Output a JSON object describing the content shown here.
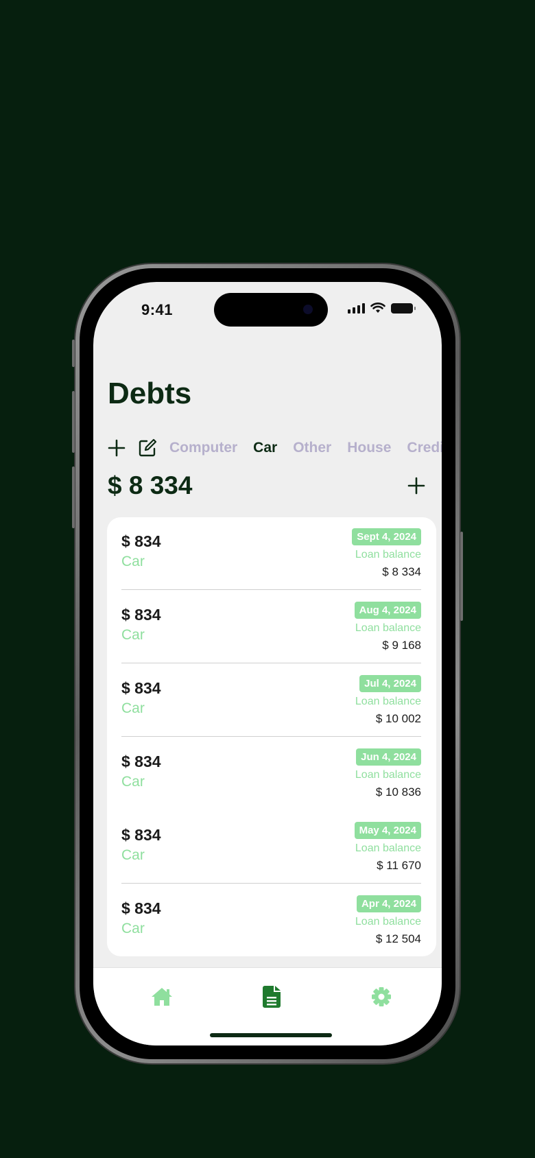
{
  "status_bar": {
    "time": "9:41"
  },
  "header": {
    "title": "Debts"
  },
  "categories": {
    "items": [
      "Computer",
      "Car",
      "Other",
      "House",
      "Credit"
    ],
    "active": "Car"
  },
  "summary": {
    "total": "$ 8 334"
  },
  "payments": [
    {
      "amount": "$ 834",
      "category": "Car",
      "date": "Sept 4, 2024",
      "balance_label": "Loan balance",
      "balance": "$ 8 334"
    },
    {
      "amount": "$ 834",
      "category": "Car",
      "date": "Aug 4, 2024",
      "balance_label": "Loan balance",
      "balance": "$ 9 168"
    },
    {
      "amount": "$ 834",
      "category": "Car",
      "date": "Jul 4, 2024",
      "balance_label": "Loan balance",
      "balance": "$ 10 002"
    },
    {
      "amount": "$ 834",
      "category": "Car",
      "date": "Jun 4, 2024",
      "balance_label": "Loan balance",
      "balance": "$ 10 836"
    },
    {
      "amount": "$ 834",
      "category": "Car",
      "date": "May 4, 2024",
      "balance_label": "Loan balance",
      "balance": "$ 11 670"
    },
    {
      "amount": "$ 834",
      "category": "Car",
      "date": "Apr 4, 2024",
      "balance_label": "Loan balance",
      "balance": "$ 12 504"
    }
  ],
  "tab_bar": {
    "items": [
      {
        "icon": "home-icon",
        "active": false
      },
      {
        "icon": "document-icon",
        "active": true
      },
      {
        "icon": "gear-icon",
        "active": false
      }
    ]
  },
  "colors": {
    "background": "#061f0e",
    "accent": "#8fdf9e",
    "active_green": "#1f7a2e",
    "title": "#0d2a14",
    "inactive_tab": "#b6b0cc"
  }
}
